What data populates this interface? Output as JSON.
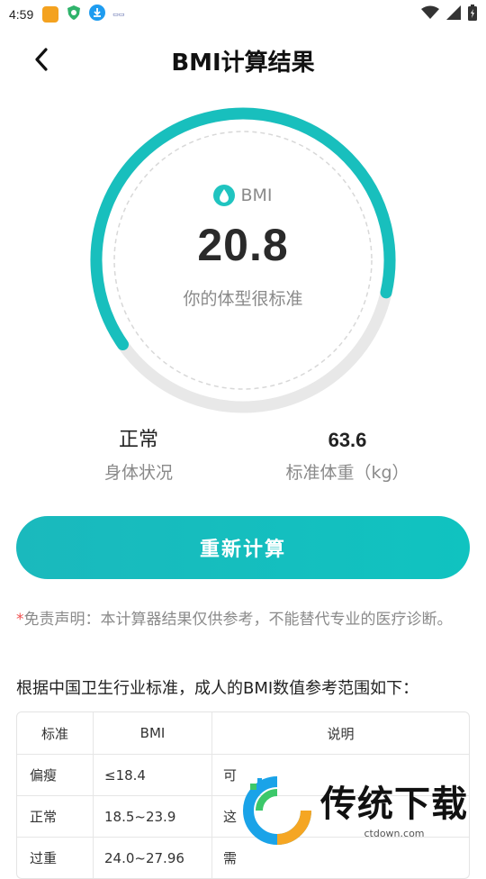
{
  "status_bar": {
    "time": "4:59",
    "icons": [
      "app-badge-icon",
      "shield-heart-icon",
      "download-icon",
      "small-logo-icon"
    ],
    "right_icons": [
      "wifi-icon",
      "signal-icon",
      "battery-icon"
    ]
  },
  "header": {
    "title": "BMI计算结果",
    "back_icon": "chevron-left-icon"
  },
  "gauge": {
    "label": "BMI",
    "value": "20.8",
    "description": "你的体型很标准",
    "fraction": 0.55,
    "accent_color": "#18bfbd",
    "track_color": "#e8e8e8"
  },
  "stats": {
    "status_value": "正常",
    "status_label": "身体状况",
    "weight_value": "63.6",
    "weight_label": "标准体重（kg）"
  },
  "recalc_button": "重新计算",
  "disclaimer": {
    "star": "*",
    "text": "免责声明：本计算器结果仅供参考，不能替代专业的医疗诊断。"
  },
  "reference": {
    "heading": "根据中国卫生行业标准，成人的BMI数值参考范围如下：",
    "columns": [
      "标准",
      "BMI",
      "说明"
    ],
    "rows": [
      {
        "standard": "偏瘦",
        "bmi": "≤18.4",
        "note": "可"
      },
      {
        "standard": "正常",
        "bmi": "18.5~23.9",
        "note": "这"
      },
      {
        "standard": "过重",
        "bmi": "24.0~27.96",
        "note": "需"
      }
    ]
  },
  "watermark": {
    "title": "传统下载",
    "url": "ctdown.com"
  }
}
